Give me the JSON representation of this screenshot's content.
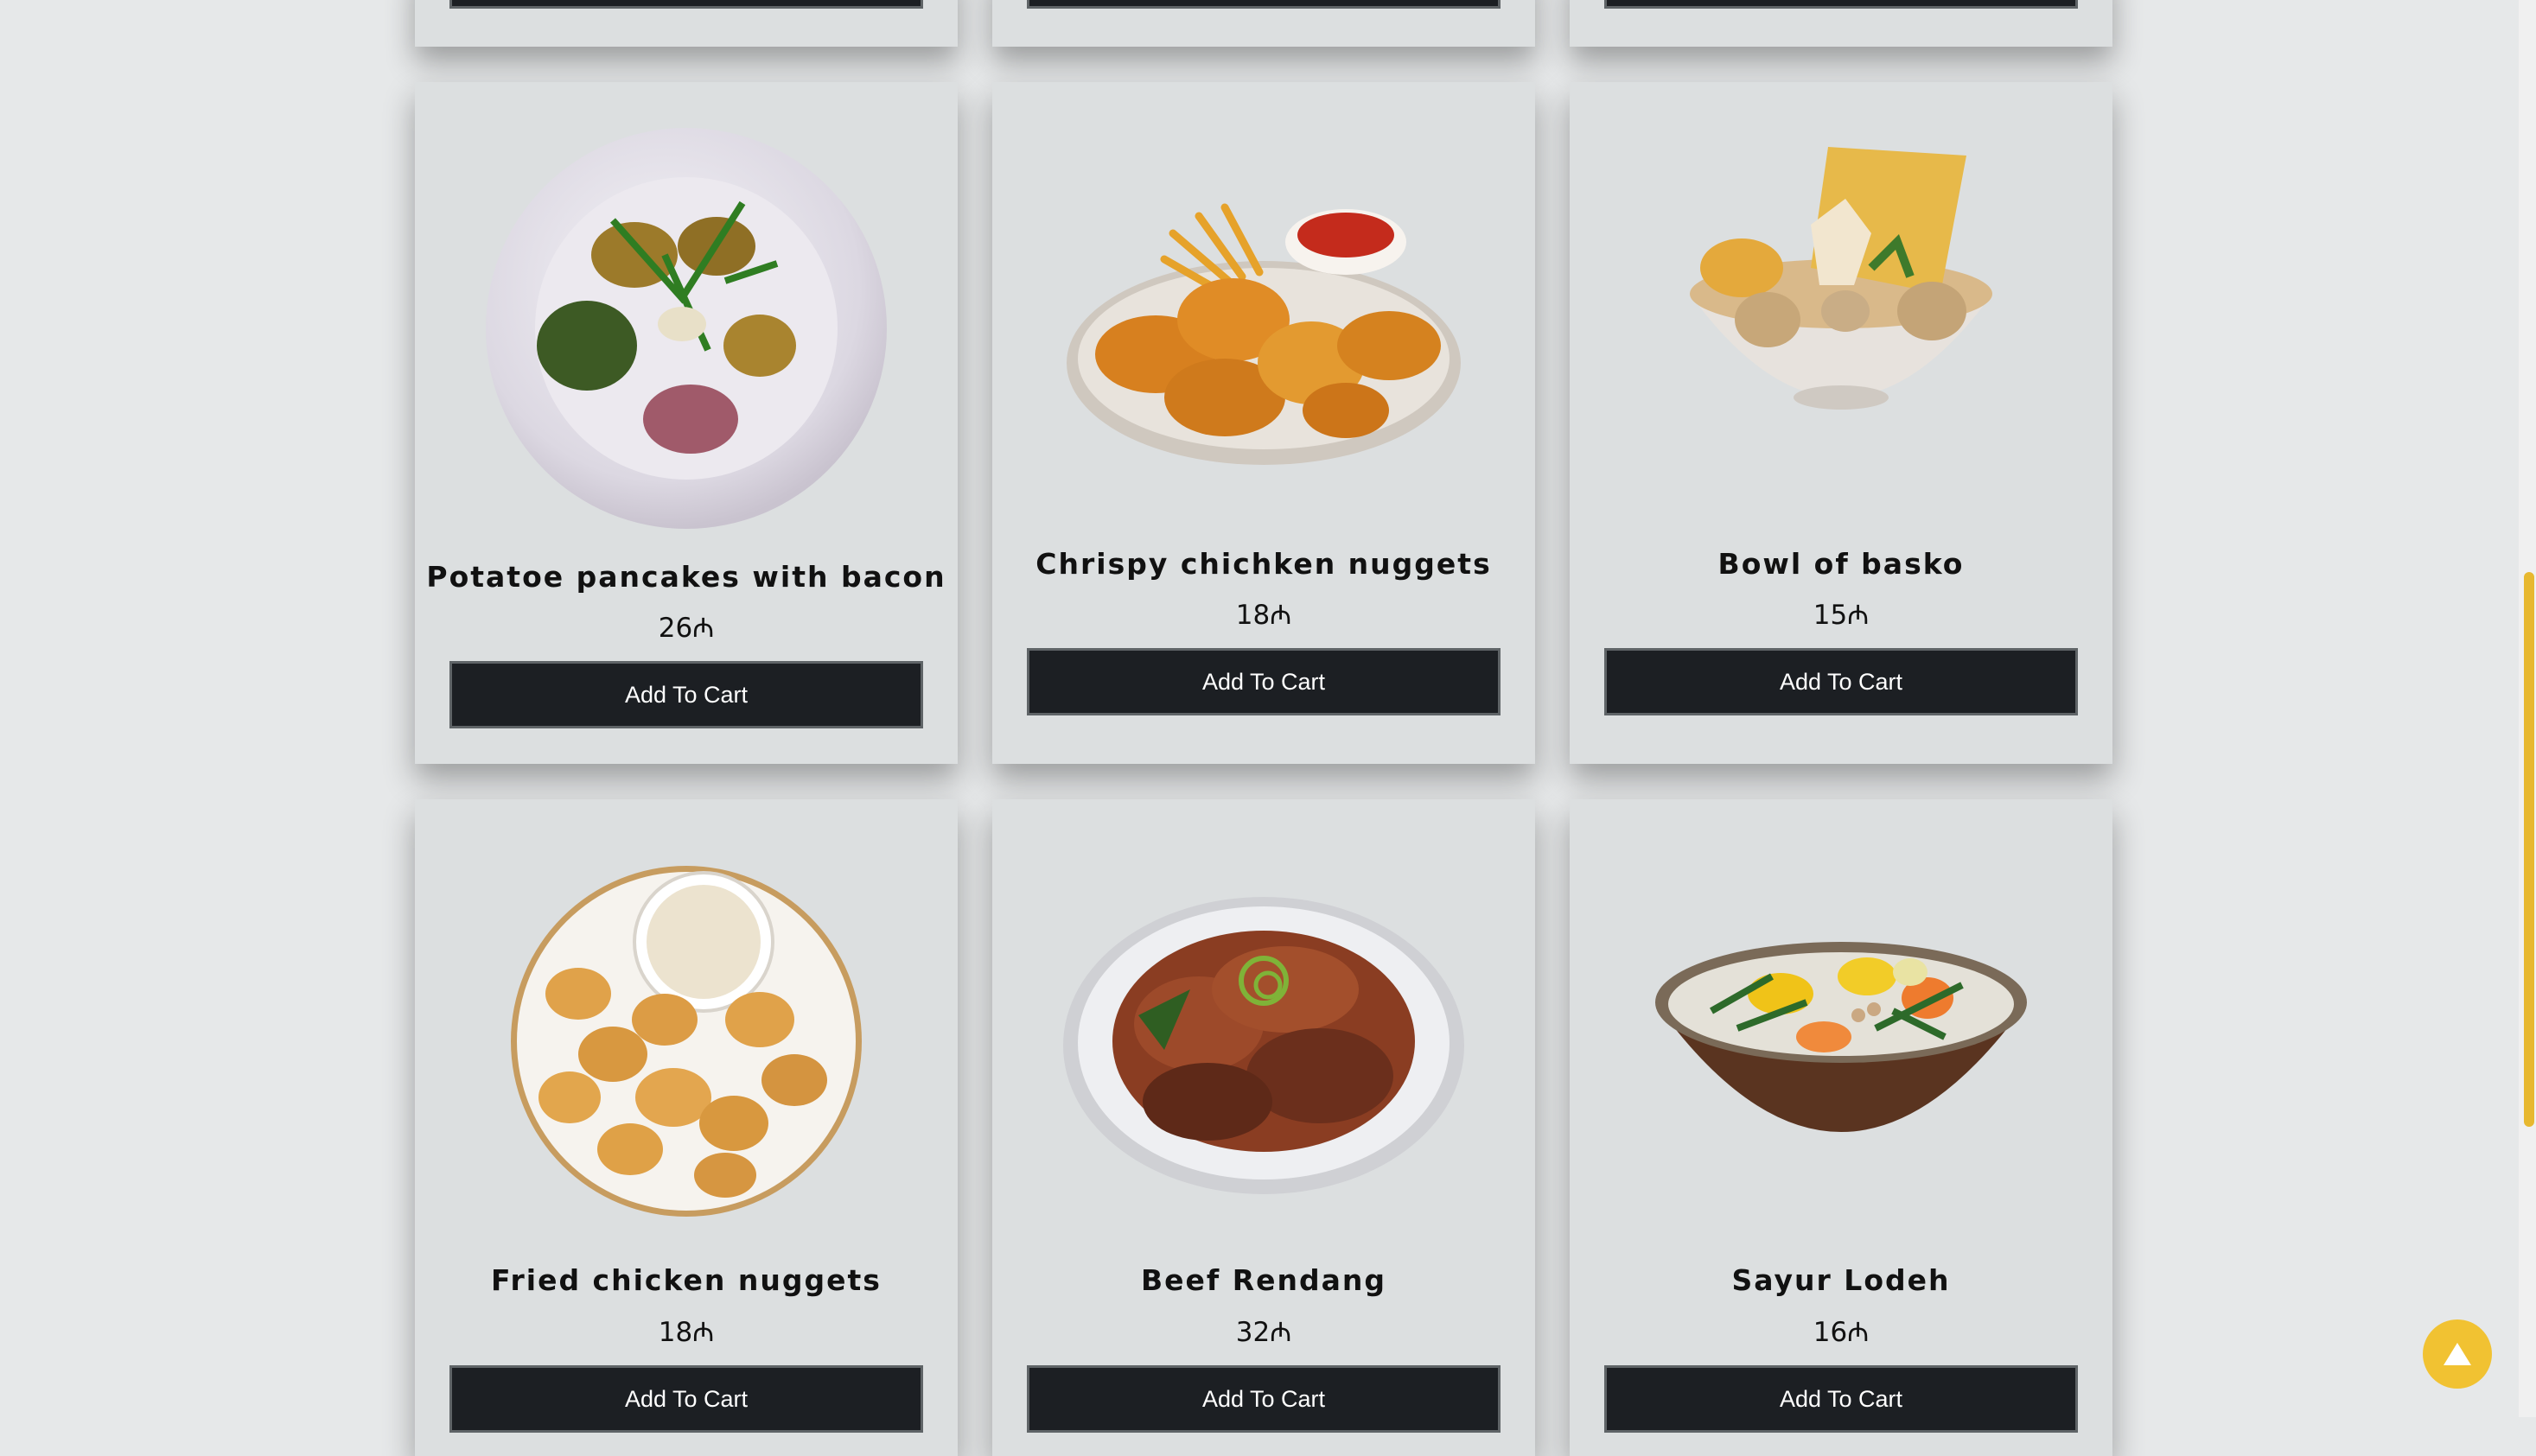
{
  "cart_button_label": "Add To Cart",
  "products": [
    {
      "name": "Potatoe pancakes with bacon",
      "price": "26₼"
    },
    {
      "name": "Chrispy chichken nuggets",
      "price": "18₼"
    },
    {
      "name": "Bowl of basko",
      "price": "15₼"
    },
    {
      "name": "Fried chicken nuggets",
      "price": "18₼"
    },
    {
      "name": "Beef Rendang",
      "price": "32₼"
    },
    {
      "name": "Sayur Lodeh",
      "price": "16₼"
    }
  ],
  "icons": {
    "back_to_top": "arrow-up-icon"
  },
  "colors": {
    "button_bg": "#1c1f23",
    "accent": "#f1c232",
    "card_bg": "#dcdfe0"
  }
}
